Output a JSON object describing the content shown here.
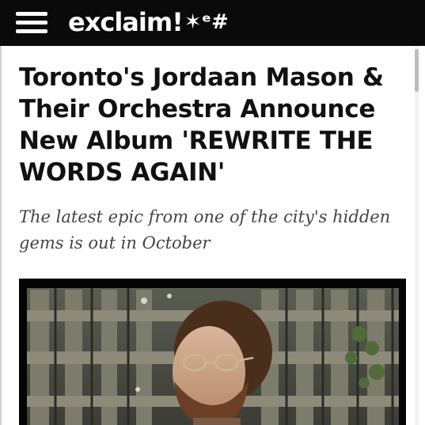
{
  "header": {
    "brand": "exclaim!",
    "brand_glyphs": "✶ᵉ#",
    "menu_icon": "hamburger-menu-icon"
  },
  "article": {
    "headline": "Toronto's Jordaan Mason & Their Orchestra Announce New Album 'REWRITE THE WORDS AGAIN'",
    "subtitle": "The latest epic from one of the city's hidden gems is out in October"
  },
  "colors": {
    "topbar": "#0a0a0a",
    "headline": "#111111",
    "subtitle": "#444444"
  }
}
